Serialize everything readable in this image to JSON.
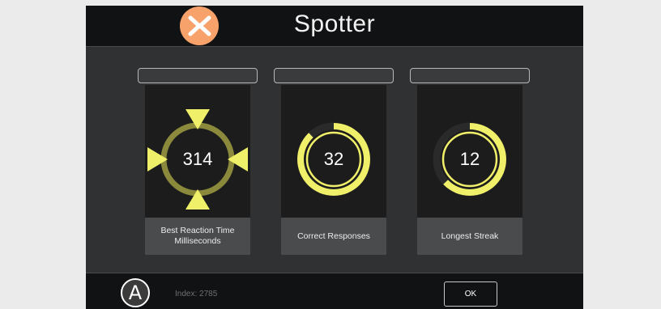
{
  "app": {
    "title": "Spotter",
    "logo_icon": "orange-chevron-logo-icon"
  },
  "colors": {
    "accent_yellow": "#f0ef6a",
    "ring_olive": "#8b8a3c",
    "logo_orange": "#f7a26a"
  },
  "cards": [
    {
      "value": "314",
      "label": "Best Reaction Time\nMilliseconds",
      "gauge": "reaction-target-icon"
    },
    {
      "value": "32",
      "label": "Correct Responses",
      "gauge": "progress-ring-icon",
      "fill_fraction": 0.88
    },
    {
      "value": "12",
      "label": "Longest Streak",
      "gauge": "progress-ring-icon",
      "fill_fraction": 0.63
    }
  ],
  "footer": {
    "badge": "A",
    "index_text": "Index: 2785",
    "ok_label": "OK"
  }
}
